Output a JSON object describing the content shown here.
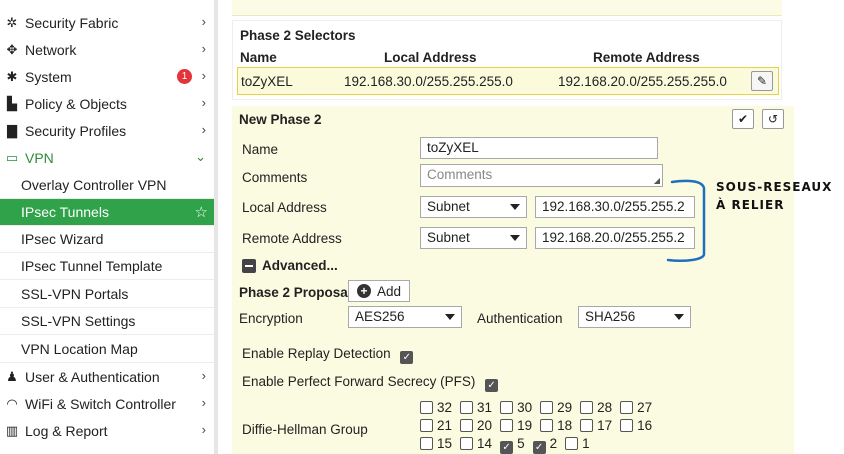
{
  "sidebar": {
    "items": [
      {
        "label": "Security Fabric",
        "icon": "fabric-icon"
      },
      {
        "label": "Network",
        "icon": "network-icon"
      },
      {
        "label": "System",
        "icon": "gear-icon",
        "badge": "1"
      },
      {
        "label": "Policy & Objects",
        "icon": "policy-icon"
      },
      {
        "label": "Security Profiles",
        "icon": "lock-icon"
      },
      {
        "label": "VPN",
        "icon": "monitor-icon"
      }
    ],
    "vpn_subitems": [
      {
        "label": "Overlay Controller VPN"
      },
      {
        "label": "IPsec Tunnels"
      },
      {
        "label": "IPsec Wizard"
      },
      {
        "label": "IPsec Tunnel Template"
      },
      {
        "label": "SSL-VPN Portals"
      },
      {
        "label": "SSL-VPN Settings"
      },
      {
        "label": "VPN Location Map"
      }
    ],
    "bottom_items": [
      {
        "label": "User & Authentication",
        "icon": "user-icon"
      },
      {
        "label": "WiFi & Switch Controller",
        "icon": "wifi-icon"
      },
      {
        "label": "Log & Report",
        "icon": "chart-icon"
      }
    ],
    "accent": "#2fa24a"
  },
  "selectors": {
    "title": "Phase 2 Selectors",
    "headers": {
      "name": "Name",
      "local": "Local Address",
      "remote": "Remote Address"
    },
    "row": {
      "name": "toZyXEL",
      "local": "192.168.30.0/255.255.255.0",
      "remote": "192.168.20.0/255.255.255.0"
    }
  },
  "new_phase2": {
    "title": "New Phase 2",
    "name_label": "Name",
    "name_value": "toZyXEL",
    "comments_label": "Comments",
    "comments_placeholder": "Comments",
    "local_label": "Local Address",
    "local_type": "Subnet",
    "local_value": "192.168.30.0/255.255.2",
    "remote_label": "Remote Address",
    "remote_type": "Subnet",
    "remote_value": "192.168.20.0/255.255.2",
    "advanced_label": "Advanced...",
    "proposal_label": "Phase 2 Proposal",
    "add_label": "Add",
    "encryption_label": "Encryption",
    "encryption_value": "AES256",
    "auth_label": "Authentication",
    "auth_value": "SHA256",
    "replay_label": "Enable Replay Detection",
    "pfs_label": "Enable Perfect Forward Secrecy (PFS)",
    "dh_label": "Diffie-Hellman Group",
    "dh_rows": [
      [
        {
          "n": "32",
          "c": false
        },
        {
          "n": "31",
          "c": false
        },
        {
          "n": "30",
          "c": false
        },
        {
          "n": "29",
          "c": false
        },
        {
          "n": "28",
          "c": false
        },
        {
          "n": "27",
          "c": false
        }
      ],
      [
        {
          "n": "21",
          "c": false
        },
        {
          "n": "20",
          "c": false
        },
        {
          "n": "19",
          "c": false
        },
        {
          "n": "18",
          "c": false
        },
        {
          "n": "17",
          "c": false
        },
        {
          "n": "16",
          "c": false
        }
      ],
      [
        {
          "n": "15",
          "c": false
        },
        {
          "n": "14",
          "c": false
        },
        {
          "n": "5",
          "c": true
        },
        {
          "n": "2",
          "c": true
        },
        {
          "n": "1",
          "c": false
        }
      ]
    ]
  },
  "annotation": {
    "line1": "SOUS-RESEAUX",
    "line2": "À RELIER",
    "color": "#1f6fc0"
  }
}
